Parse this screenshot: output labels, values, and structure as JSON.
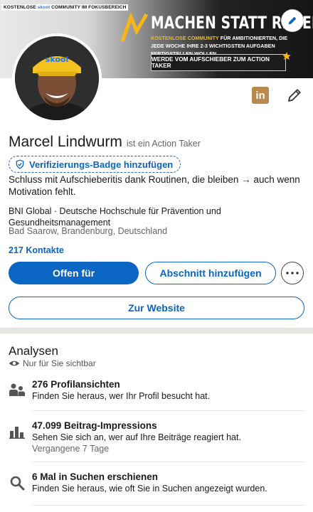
{
  "banner": {
    "tag_prefix": "KOSTENLOSE ",
    "tag_brand": "skool",
    "tag_suffix": " COMMUNITY IM FOKUSBEREICH",
    "title": "MACHEN STATT REDEN",
    "subtitle_highlight": "KOSTENLOSE COMMUNITY",
    "subtitle_rest": " FÜR AMBITIONIERTEN, DIE JEDE WOCHE IHRE 2-3 WICHTIGSTEN AUFGABEN FERTIGSTELLEN WOLLEN",
    "cta": "WERDE VOM AUFSCHIEBER ZUM ACTION TAKER",
    "cap_text": "skool"
  },
  "profile": {
    "name": "Marcel Lindwurm",
    "tagline": "ist ein Action Taker",
    "verify_label": "Verifizierungs-Badge hinzufügen",
    "headline": "Schluss mit Aufschieberitis dank Routinen, die bleiben → auch wenn Motivation fehlt.",
    "education": "BNI Global · Deutsche Hochschule für Prävention und Gesundheitsmanagement",
    "location": "Bad Saarow, Brandenburg, Deutschland",
    "contacts": "217 Kontakte",
    "linkedin_icon_text": "in"
  },
  "actions": {
    "open_for": "Offen für",
    "add_section": "Abschnitt hinzufügen",
    "website": "Zur Website"
  },
  "analytics": {
    "title": "Analysen",
    "visibility": "Nur für Sie sichtbar",
    "items": [
      {
        "title": "276 Profilansichten",
        "desc": "Finden Sie heraus, wer Ihr Profil besucht hat.",
        "sub": ""
      },
      {
        "title": "47.099 Beitrag-Impressions",
        "desc": "Sehen Sie sich an, wer auf Ihre Beiträge reagiert hat.",
        "sub": "Vergangene 7 Tage"
      },
      {
        "title": "6 Mal in Suchen erschienen",
        "desc": "Finden Sie heraus, wie oft Sie in Suchen angezeigt wurden.",
        "sub": ""
      }
    ]
  },
  "colors": {
    "primary": "#0a66c2",
    "banner_accent": "#f7b614",
    "linkedin_badge": "#b98a4b"
  },
  "icons": [
    "pencil-icon",
    "linkedin-icon",
    "shield-check-icon",
    "more-icon",
    "eye-icon",
    "people-icon",
    "bar-chart-icon",
    "search-icon",
    "star-icon"
  ]
}
